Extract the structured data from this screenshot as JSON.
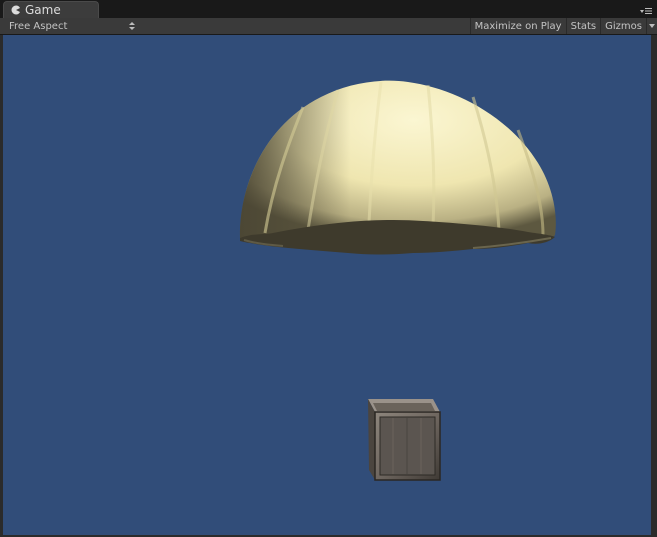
{
  "window": {
    "tab_title": "Game",
    "tab_icon": "pacman-game-icon"
  },
  "toolbar": {
    "aspect_label": "Free Aspect",
    "maximize_label": "Maximize on Play",
    "stats_label": "Stats",
    "gizmos_label": "Gizmos"
  },
  "viewport": {
    "background_color": "#314d79",
    "objects": [
      "parachute",
      "wooden-crate"
    ]
  },
  "colors": {
    "canopy": "#f2ecb8",
    "canopy_shadow": "#3e3a2c",
    "crate": "#5a534d"
  }
}
